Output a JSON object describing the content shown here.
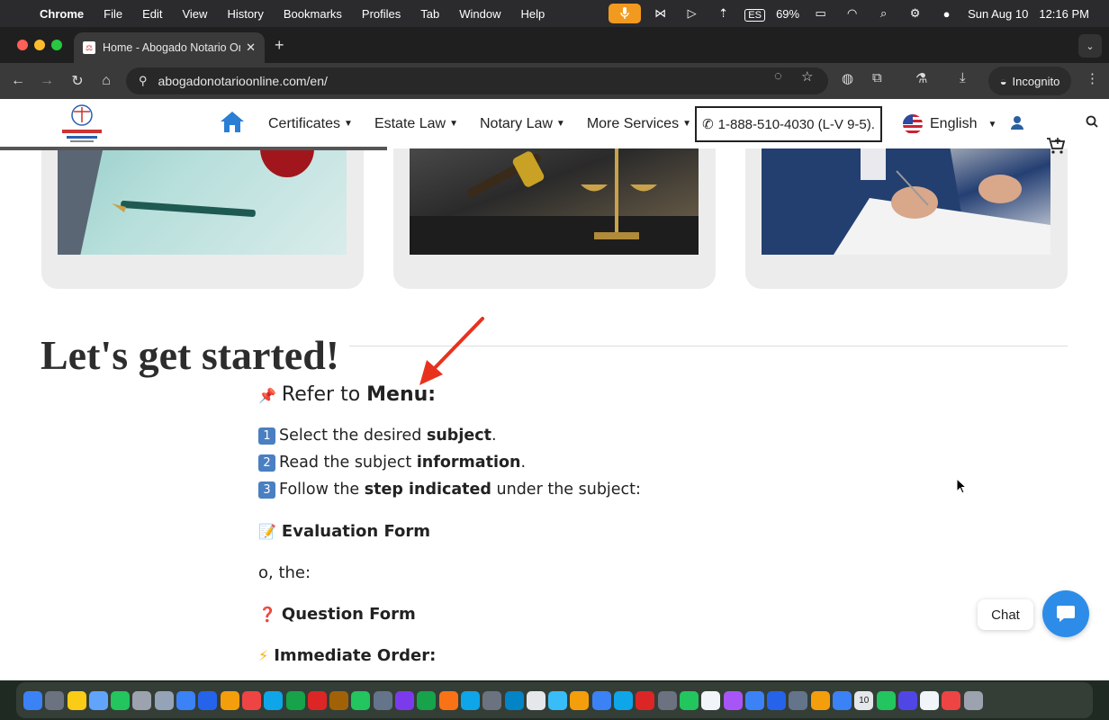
{
  "menubar": {
    "app": "Chrome",
    "items": [
      "File",
      "Edit",
      "View",
      "History",
      "Bookmarks",
      "Profiles",
      "Tab",
      "Window",
      "Help"
    ],
    "keyboard": "ES",
    "battery": "69%",
    "date": "Sun Aug 10",
    "time": "12:16 PM"
  },
  "tab": {
    "title": "Home - Abogado Notario Onl",
    "close": "✕",
    "new_tab": "+"
  },
  "toolbar": {
    "url": "abogadonotarioonline.com/en/",
    "incognito": "Incognito"
  },
  "site": {
    "nav": [
      "Certificates",
      "Estate Law",
      "Notary Law",
      "More Services"
    ],
    "phone": "1-888-510-4030 (L-V 9-5).",
    "language": "English"
  },
  "main": {
    "heading": "Let's get started!",
    "refer_prefix": "Refer to ",
    "refer_bold": "Menu:",
    "steps": [
      {
        "num": "1",
        "pre": "Select the desired ",
        "bold": "subject",
        "post": "."
      },
      {
        "num": "2",
        "pre": "Read the subject ",
        "bold": "information",
        "post": "."
      },
      {
        "num": "3",
        "pre": "Follow the ",
        "bold": "step indicated",
        "post": " under the subject:"
      }
    ],
    "evaluation_form": "Evaluation Form",
    "or_the": "o, the:",
    "question_form": "Question Form",
    "immediate_order": "Immediate Order:"
  },
  "chat": {
    "label": "Chat"
  },
  "dock": {
    "calendar_day": "10",
    "colors": [
      "#3b82f6",
      "#6b7280",
      "#facc15",
      "#60a5fa",
      "#22c55e",
      "#9ca3af",
      "#94a3b8",
      "#3b82f6",
      "#2563eb",
      "#f59e0b",
      "#ef4444",
      "#0ea5e9",
      "#16a34a",
      "#dc2626",
      "#a16207",
      "#22c55e",
      "#64748b",
      "#7c3aed",
      "#16a34a",
      "#f97316",
      "#0ea5e9",
      "#6b7280",
      "#0284c7",
      "#e5e7eb",
      "#38bdf8",
      "#f59e0b",
      "#3b82f6",
      "#0ea5e9",
      "#dc2626",
      "#6b7280",
      "#22c55e",
      "#f1f5f9",
      "#a855f7",
      "#3b82f6",
      "#2563eb",
      "#64748b",
      "#f59e0b",
      "#3b82f6",
      "#e5e7eb",
      "#22c55e",
      "#4f46e5",
      "#f1f5f9",
      "#ef4444",
      "#9ca3af"
    ]
  }
}
